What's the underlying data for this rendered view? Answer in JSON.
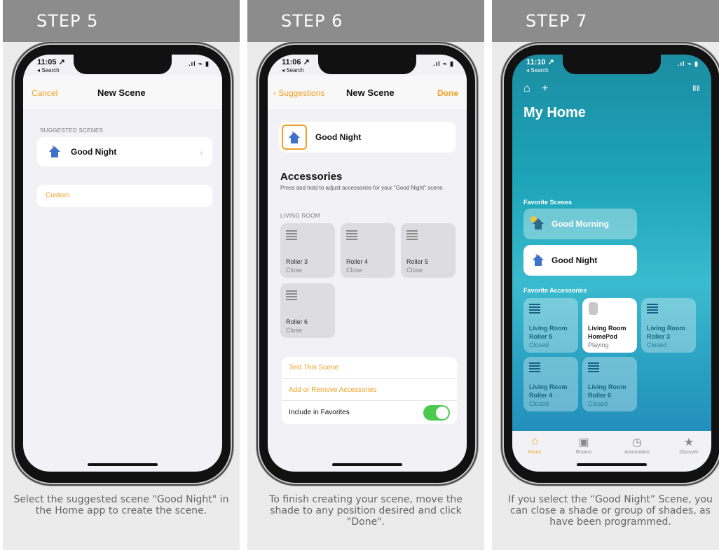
{
  "panels": [
    {
      "step": "STEP 5",
      "caption": "Select the suggested scene \"Good Night\" in the Home app to create the scene.",
      "status": {
        "time": "11:05 ↗",
        "sub": "◂ Search",
        "icons": ".ıl ⌁ ▮"
      },
      "nav": {
        "left": "Cancel",
        "title": "New Scene"
      },
      "section": "SUGGESTED SCENES",
      "scene_name": "Good Night",
      "chevron": "›",
      "custom": "Custom"
    },
    {
      "step": "STEP 6",
      "caption": "To finish creating your scene, move the shade to any position desired and click \"Done\".",
      "status": {
        "time": "11:06 ↗",
        "sub": "◂ Search",
        "icons": ".ıl ⌁ ▮"
      },
      "nav": {
        "left": "‹ Suggestions",
        "title": "New Scene",
        "right": "Done"
      },
      "scene_name": "Good Night",
      "accessories_title": "Accessories",
      "accessories_hint": "Press and hold to adjust accessories for your \"Good Night\" scene.",
      "room": "LIVING ROOM",
      "tiles": [
        {
          "name": "Roller 3",
          "state": "Close"
        },
        {
          "name": "Roller 4",
          "state": "Close"
        },
        {
          "name": "Roller 5",
          "state": "Close"
        },
        {
          "name": "Roller 6",
          "state": "Close"
        }
      ],
      "actions": {
        "test": "Test This Scene",
        "add_remove": "Add or Remove Accessories",
        "favorites": "Include in Favorites"
      },
      "favorites_on": true
    },
    {
      "step": "STEP 7",
      "caption": "If you select the “Good Night” Scene, you can close a shade or group of shades, as have been programmed.",
      "status": {
        "time": "11:10 ↗",
        "sub": "◂ Search",
        "icons": ".ıl ⌁ ▮"
      },
      "home_title": "My Home",
      "icons": {
        "home": "⌂",
        "plus": "+",
        "voice": "ⅡⅡ"
      },
      "favorite_scenes": "Favorite Scenes",
      "scenes": [
        {
          "name": "Good Morning"
        },
        {
          "name": "Good Night"
        }
      ],
      "favorite_accessories": "Favorite Accessories",
      "accessories": [
        {
          "line1": "Living Room",
          "line2": "Roller 5",
          "state": "Closed"
        },
        {
          "line1": "Living Room",
          "line2": "HomePod",
          "state": "Playing"
        },
        {
          "line1": "Living Room",
          "line2": "Roller 3",
          "state": "Closed"
        },
        {
          "line1": "Living Room",
          "line2": "Roller 4",
          "state": "Closed"
        },
        {
          "line1": "Living Room",
          "line2": "Roller 6",
          "state": "Closed"
        }
      ],
      "tabs": [
        {
          "label": "Home",
          "icon": "⌂"
        },
        {
          "label": "Rooms",
          "icon": "▣"
        },
        {
          "label": "Automation",
          "icon": "◷"
        },
        {
          "label": "Discover",
          "icon": "★"
        }
      ]
    }
  ],
  "colors": {
    "accent": "#f0a024",
    "toggle": "#4cc94f",
    "header": "#8c8c8c"
  }
}
